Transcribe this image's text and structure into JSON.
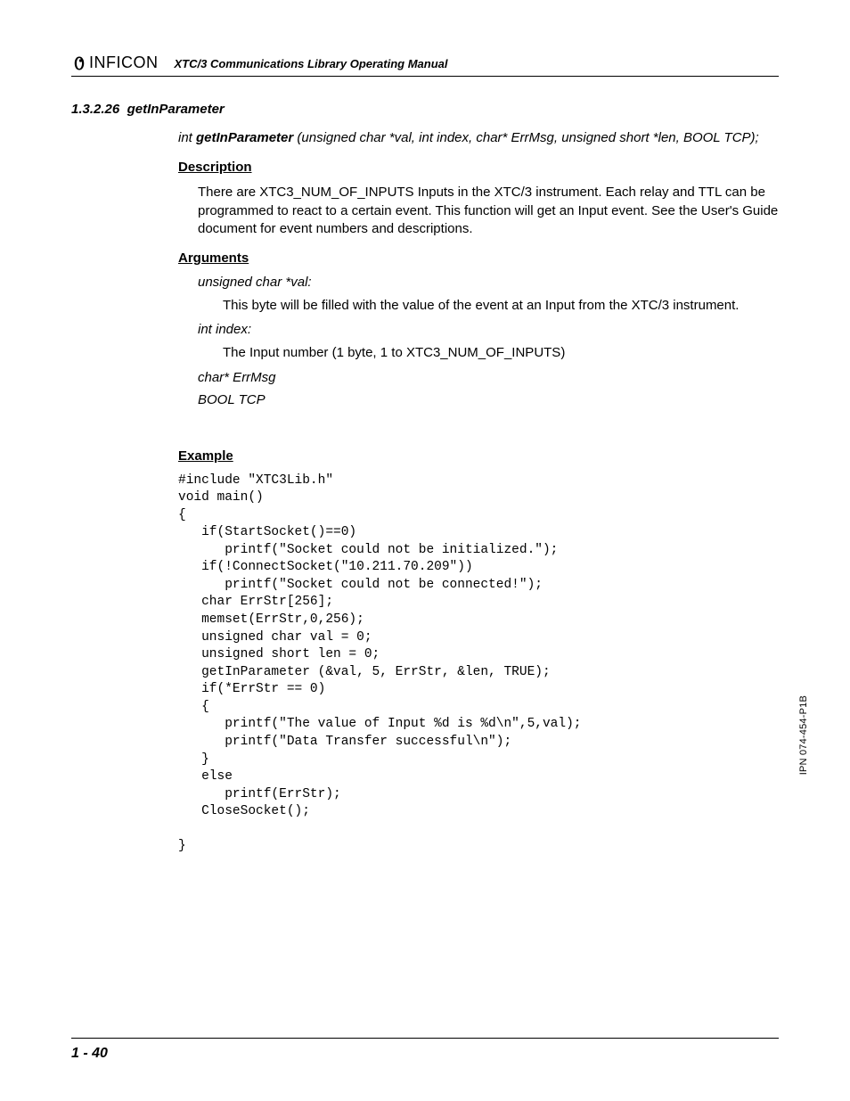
{
  "header": {
    "brand": "INFICON",
    "manual_title": "XTC/3 Communications Library Operating Manual"
  },
  "section": {
    "number": "1.3.2.26",
    "title": "getInParameter"
  },
  "signature": {
    "return_type": "int ",
    "fn_name": "getInParameter",
    "params": " (unsigned char *val, int index, char* ErrMsg, unsigned short *len, BOOL TCP);"
  },
  "description": {
    "heading": "Description",
    "text": "There are XTC3_NUM_OF_INPUTS Inputs in the XTC/3 instrument. Each relay and TTL can be programmed to react to a certain event. This function will get an Input event. See the User's Guide document for event numbers and descriptions."
  },
  "arguments": {
    "heading": "Arguments",
    "items": [
      {
        "name": "unsigned char *val:",
        "desc": "This byte will be filled with the value of the event at an Input from the XTC/3 instrument."
      },
      {
        "name": "int index:",
        "desc": "The Input number (1 byte, 1 to XTC3_NUM_OF_INPUTS)"
      },
      {
        "name": "char* ErrMsg",
        "desc": ""
      },
      {
        "name": "BOOL TCP",
        "desc": ""
      }
    ]
  },
  "example": {
    "heading": "Example",
    "code": "#include \"XTC3Lib.h\"\nvoid main()\n{\n   if(StartSocket()==0)\n      printf(\"Socket could not be initialized.\");\n   if(!ConnectSocket(\"10.211.70.209\"))\n      printf(\"Socket could not be connected!\");\n   char ErrStr[256];\n   memset(ErrStr,0,256);\n   unsigned char val = 0;\n   unsigned short len = 0;\n   getInParameter (&val, 5, ErrStr, &len, TRUE);\n   if(*ErrStr == 0)\n   {\n      printf(\"The value of Input %d is %d\\n\",5,val);\n      printf(\"Data Transfer successful\\n\");\n   }\n   else\n      printf(ErrStr);\n   CloseSocket();\n\n}"
  },
  "footer": {
    "page": "1 - 40"
  },
  "side_label": "IPN 074-454-P1B"
}
